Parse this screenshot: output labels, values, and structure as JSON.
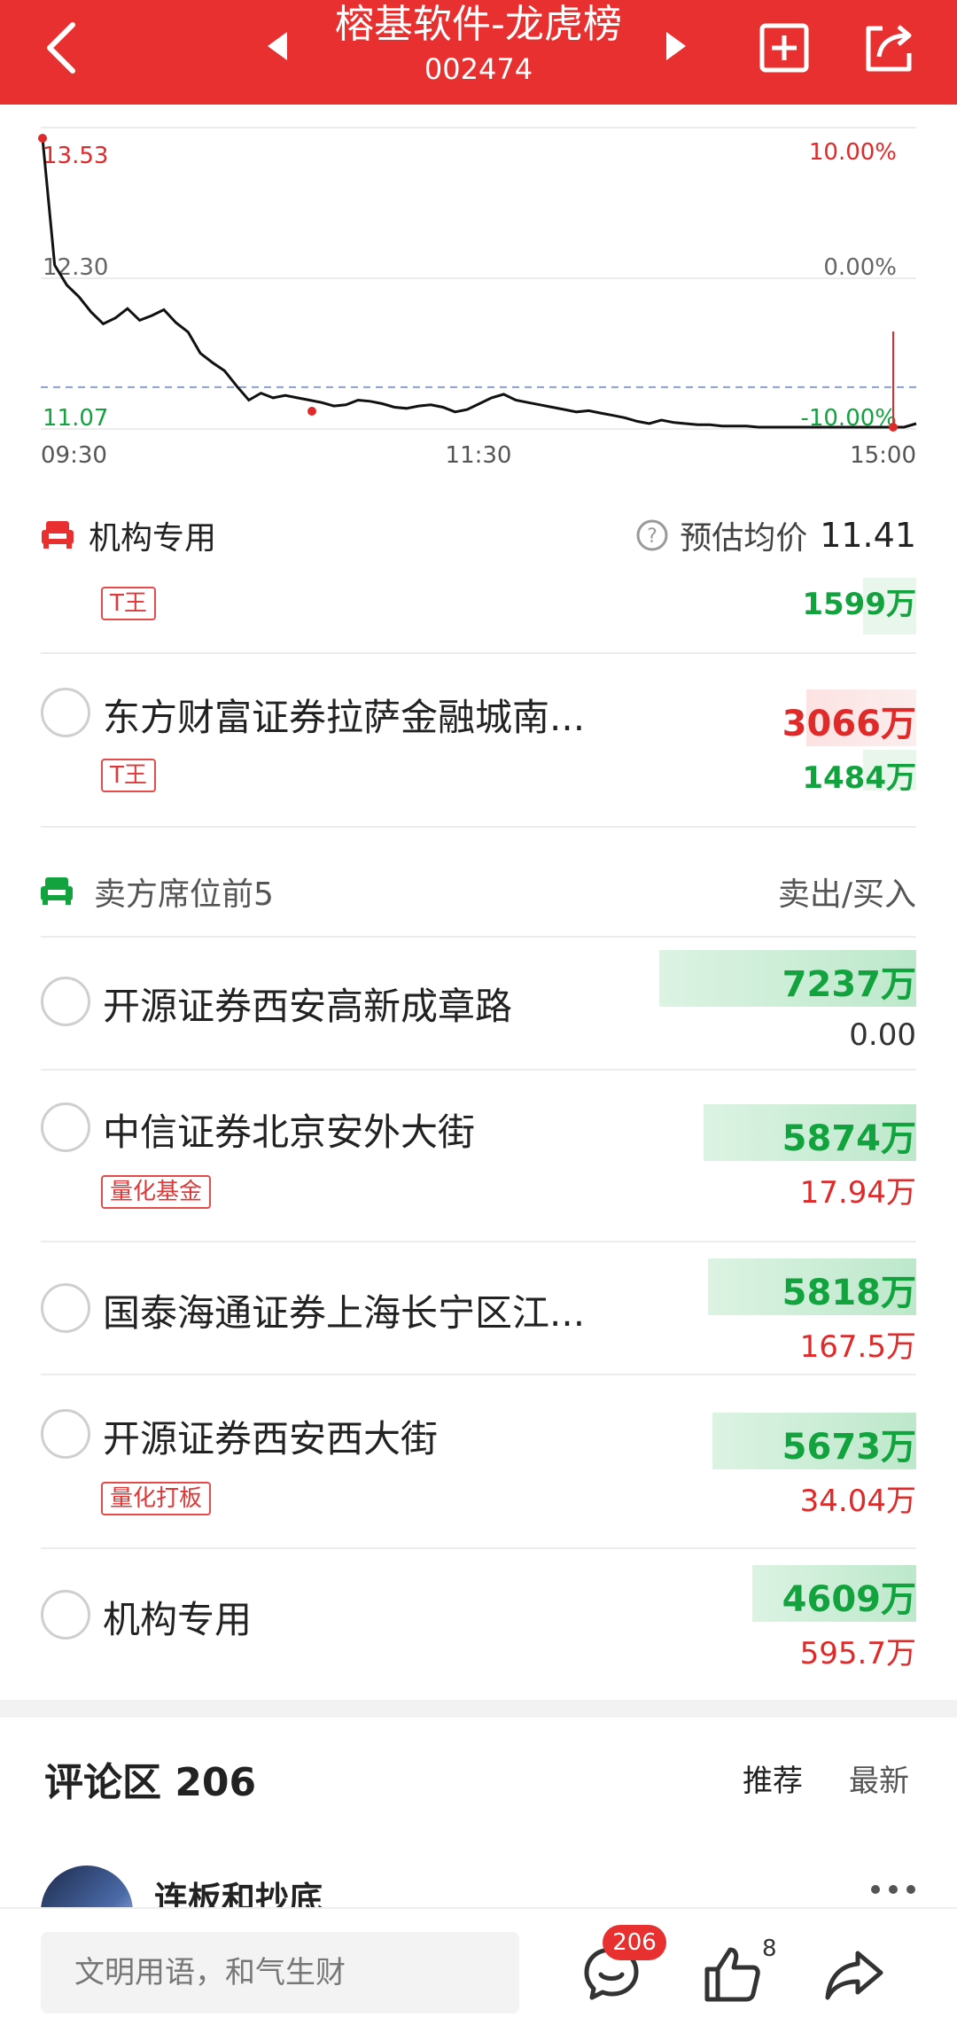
{
  "header": {
    "title": "榕基软件-龙虎榜",
    "code": "002474",
    "bg_color": "#e93030"
  },
  "chart_data": {
    "type": "line",
    "y_labels": [
      "13.53",
      "12.30",
      "11.07"
    ],
    "pct_labels": [
      "10.00%",
      "0.00%",
      "-10.00%"
    ],
    "x_labels": [
      "09:30",
      "11:30",
      "15:00"
    ],
    "ylim": [
      11.07,
      13.53
    ],
    "open": 12.3,
    "avg_line": 11.41,
    "series": [
      {
        "values": [
          13.53,
          12.45,
          12.28,
          12.18,
          12.05,
          11.95,
          12.0,
          12.08,
          11.98,
          12.02,
          12.07,
          11.96,
          11.88,
          11.7,
          11.62,
          11.55,
          11.42,
          11.3,
          11.36,
          11.32,
          11.34,
          11.32,
          11.3,
          11.28,
          11.25,
          11.26,
          11.3,
          11.29,
          11.27,
          11.24,
          11.23,
          11.25,
          11.26,
          11.24,
          11.2,
          11.22,
          11.27,
          11.32,
          11.35,
          11.3,
          11.28,
          11.26,
          11.24,
          11.22,
          11.2,
          11.21,
          11.19,
          11.17,
          11.15,
          11.12,
          11.1,
          11.13,
          11.11,
          11.1,
          11.09,
          11.09,
          11.08,
          11.08,
          11.08,
          11.07,
          11.07,
          11.07,
          11.07,
          11.07,
          11.07,
          11.07,
          11.07,
          11.07,
          11.07,
          11.07,
          11.07,
          11.07,
          11.1
        ]
      }
    ]
  },
  "inst_section": {
    "label": "机构专用",
    "est_label": "预估均价",
    "est_value": "11.41"
  },
  "partial_row": {
    "tag": "T王",
    "value": "1599万"
  },
  "row_dongfang": {
    "name": "东方财富证券拉萨金融城南...",
    "tag": "T王",
    "buy": "3066万",
    "sell": "1484万"
  },
  "sell_section": {
    "title": "卖方席位前5",
    "right_label": "卖出/买入"
  },
  "sell_rows": [
    {
      "name": "开源证券西安高新成章路",
      "tag": "",
      "sell": "7237万",
      "buy": "0.00",
      "bar_pct": 0.58
    },
    {
      "name": "中信证券北京安外大街",
      "tag": "量化基金",
      "sell": "5874万",
      "buy": "17.94万",
      "bar_pct": 0.48
    },
    {
      "name": "国泰海通证券上海长宁区江...",
      "tag": "",
      "sell": "5818万",
      "buy": "167.5万",
      "bar_pct": 0.47
    },
    {
      "name": "开源证券西安西大街",
      "tag": "量化打板",
      "sell": "5673万",
      "buy": "34.04万",
      "bar_pct": 0.46
    },
    {
      "name": "机构专用",
      "tag": "",
      "sell": "4609万",
      "buy": "595.7万",
      "bar_pct": 0.37
    }
  ],
  "comments": {
    "title": "评论区 206",
    "tab_recommend": "推荐",
    "tab_latest": "最新",
    "first_user": "连板和抄底"
  },
  "bottom_bar": {
    "input_placeholder": "文明用语，和气生财",
    "comment_count": "206",
    "like_count": "8"
  }
}
